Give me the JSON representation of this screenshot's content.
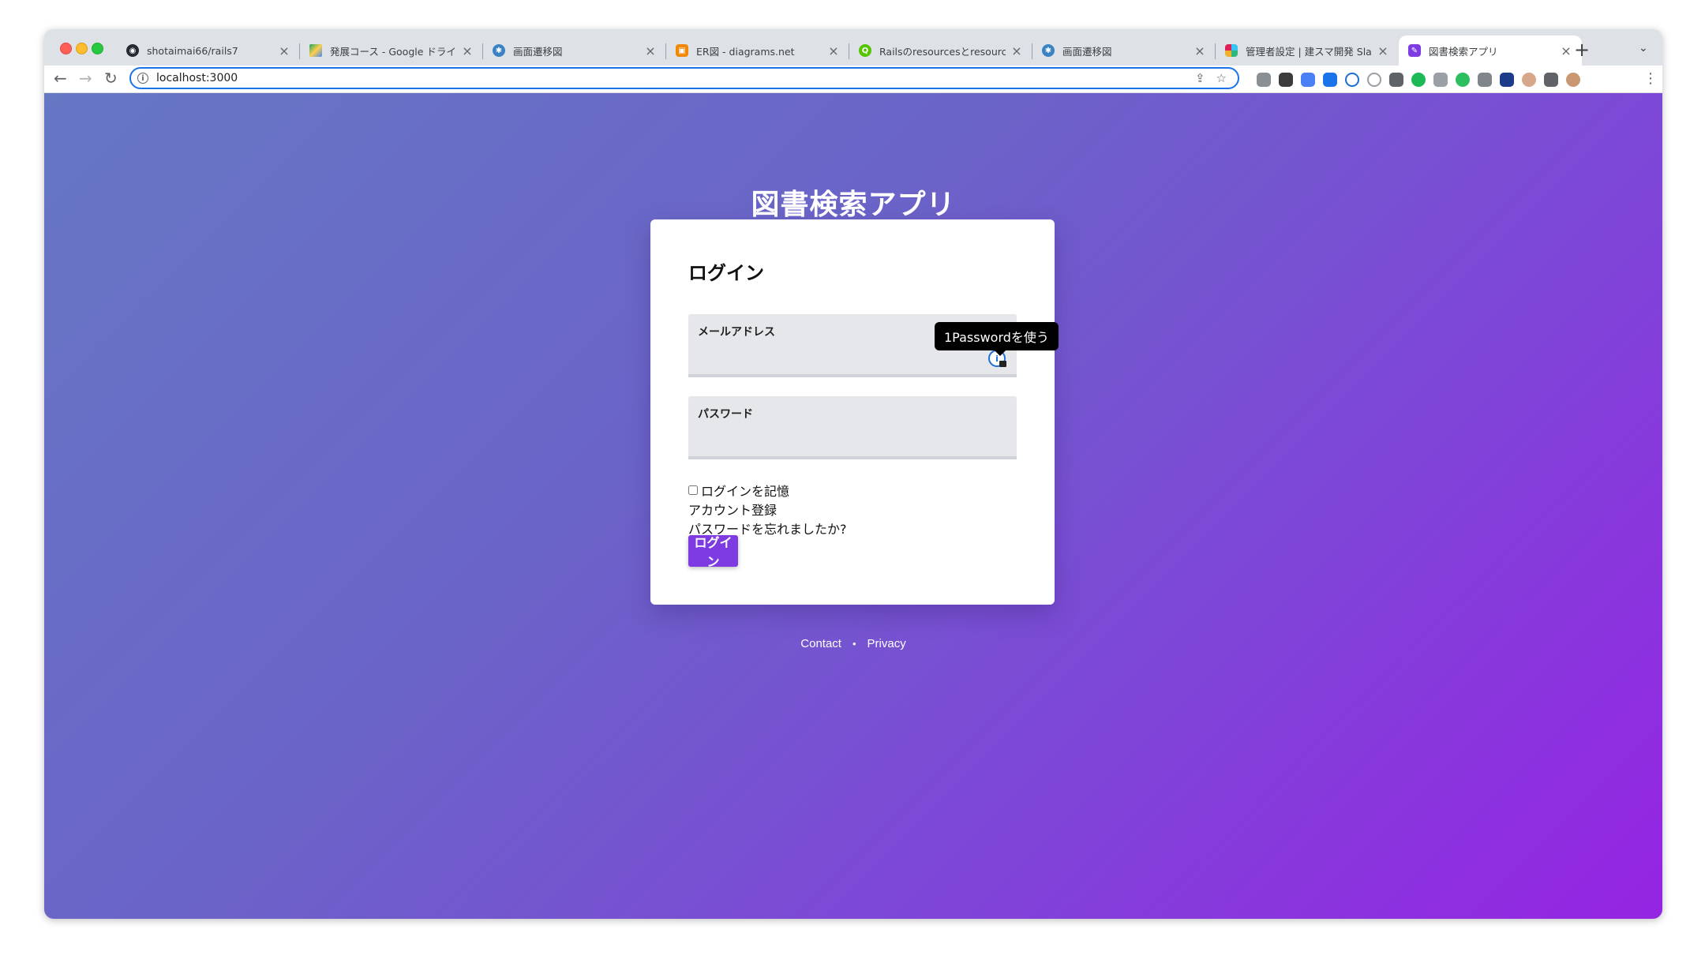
{
  "browser": {
    "tabs": [
      {
        "title": "shotaimai66/rails7",
        "icon": "github-icon",
        "color": "#24292f"
      },
      {
        "title": "発展コース - Google ドライブ",
        "icon": "google-drive-icon",
        "color": "#1fa463"
      },
      {
        "title": "画面遷移図",
        "icon": "diagram-icon",
        "color": "#3b82c4"
      },
      {
        "title": "ER図 - diagrams.net",
        "icon": "drawio-icon",
        "color": "#f08705"
      },
      {
        "title": "Railsのresourcesとresourceの",
        "icon": "qiita-icon",
        "color": "#55c500"
      },
      {
        "title": "画面遷移図",
        "icon": "diagram-icon",
        "color": "#3b82c4"
      },
      {
        "title": "管理者設定 | 建スマ開発 Slack",
        "icon": "slack-icon",
        "color": "#4a154b"
      },
      {
        "title": "図書検索アプリ",
        "icon": "app-icon",
        "color": "#7e3be2",
        "active": true
      }
    ],
    "url": "localhost:3000"
  },
  "page": {
    "app_title": "図書検索アプリ",
    "login_title": "ログイン",
    "email_label": "メールアドレス",
    "password_label": "パスワード",
    "onepassword_tooltip": "1Passwordを使う",
    "remember_label": "ログインを記憶",
    "signup_link": "アカウント登録",
    "forgot_link": "パスワードを忘れましたか?",
    "login_button": "ログイン",
    "footer": {
      "contact": "Contact",
      "separator": "•",
      "privacy": "Privacy"
    }
  },
  "colors": {
    "accent": "#7e3be2",
    "gradient_start": "#6677c4",
    "gradient_end": "#9524e3"
  }
}
